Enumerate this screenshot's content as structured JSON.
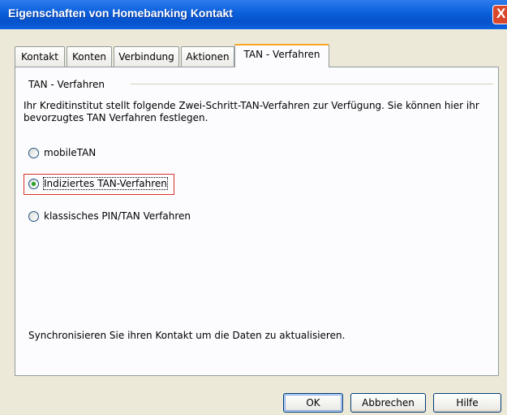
{
  "window": {
    "title": "Eigenschaften von Homebanking Kontakt",
    "close_label": "X"
  },
  "tabs": [
    {
      "label": "Kontakt"
    },
    {
      "label": "Konten"
    },
    {
      "label": "Verbindung"
    },
    {
      "label": "Aktionen"
    },
    {
      "label": "TAN - Verfahren",
      "active": true
    }
  ],
  "panel": {
    "group_title": "TAN - Verfahren",
    "description": "Ihr Kreditinstitut stellt folgende Zwei-Schritt-TAN-Verfahren zur Verfügung. Sie können hier ihr bevorzugtes TAN Verfahren festlegen.",
    "options": [
      {
        "label": "mobileTAN",
        "checked": false
      },
      {
        "label": "Indiziertes TAN-Verfahren",
        "checked": true
      },
      {
        "label": "klassisches PIN/TAN Verfahren",
        "checked": false
      }
    ],
    "sync_text": "Synchronisieren Sie ihren Kontakt um die Daten zu aktualisieren."
  },
  "buttons": {
    "ok": "OK",
    "cancel": "Abbrechen",
    "help": "Hilfe"
  },
  "colors": {
    "titlebar": "#0A5FDB",
    "highlight_box": "#D9312B",
    "active_tab_accent": "#F5A623"
  }
}
